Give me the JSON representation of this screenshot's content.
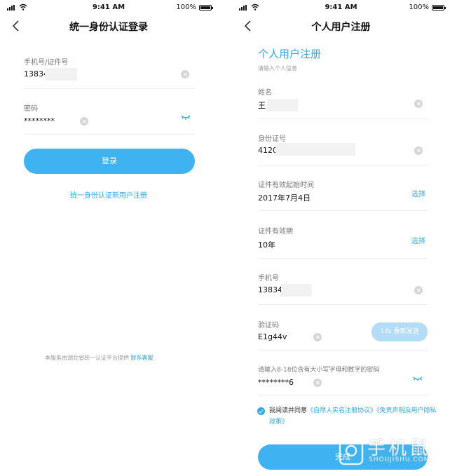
{
  "status_bar": {
    "time": "9:41 AM",
    "battery": "100%"
  },
  "login": {
    "title": "统一身份认证登录",
    "account_label": "手机号/证件号",
    "account_value": "13834",
    "password_label": "密码",
    "password_value": "********",
    "login_button": "登录",
    "register_link": "统一身份认证新用户注册",
    "footer_text": "本服务由湖北省统一认证平台提供",
    "footer_link": "联系客服"
  },
  "register": {
    "title": "个人用户注册",
    "heading": "个人用户注册",
    "subheading": "请输入个人信息",
    "name_label": "姓名",
    "name_value": "王",
    "id_label": "身份证号",
    "id_value": "4120",
    "valid_start_label": "证件有效起始时间",
    "valid_start_value": "2017年7月4日",
    "valid_period_label": "证件有效期",
    "valid_period_value": "10年",
    "select_label": "选择",
    "phone_label": "手机号",
    "phone_value": "13834",
    "code_label": "验证码",
    "code_value": "E1g44v",
    "resend_button": "10s 重新发送",
    "password_label": "请输入8-18位含有大小写字母和数字的密码",
    "password_value": "********6",
    "agree_prefix": "我阅读并同意",
    "agree_link1": "《自然人实名注册协议》",
    "agree_link2": "《免责声明及用户隐私政策》",
    "finish_button": "完成"
  },
  "watermark": {
    "brand": "手机鼠",
    "domain": "SHOUJISHU.COM"
  },
  "colors": {
    "accent": "#2ea7ea",
    "button": "#3fb3f2",
    "button_disabled": "#b4dcf6"
  }
}
